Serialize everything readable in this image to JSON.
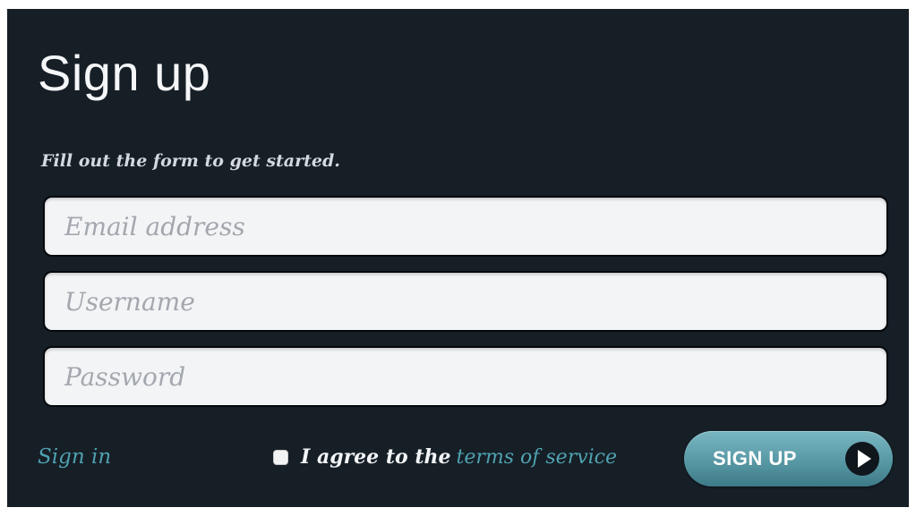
{
  "form": {
    "title": "Sign up",
    "subtitle": "Fill out the form to get started.",
    "fields": {
      "email": {
        "placeholder": "Email address",
        "value": ""
      },
      "username": {
        "placeholder": "Username",
        "value": ""
      },
      "password": {
        "placeholder": "Password",
        "value": ""
      }
    },
    "signin_label": "Sign in",
    "agree": {
      "checked": false,
      "text": "I agree to the",
      "terms_label": "terms of service"
    },
    "submit_label": "SIGN UP",
    "submit_icon": "play-circle-icon"
  },
  "colors": {
    "panel_background": "#161e26",
    "accent": "#4fa2b0",
    "button": "#5b9ba8",
    "input_background": "#f3f4f6"
  }
}
